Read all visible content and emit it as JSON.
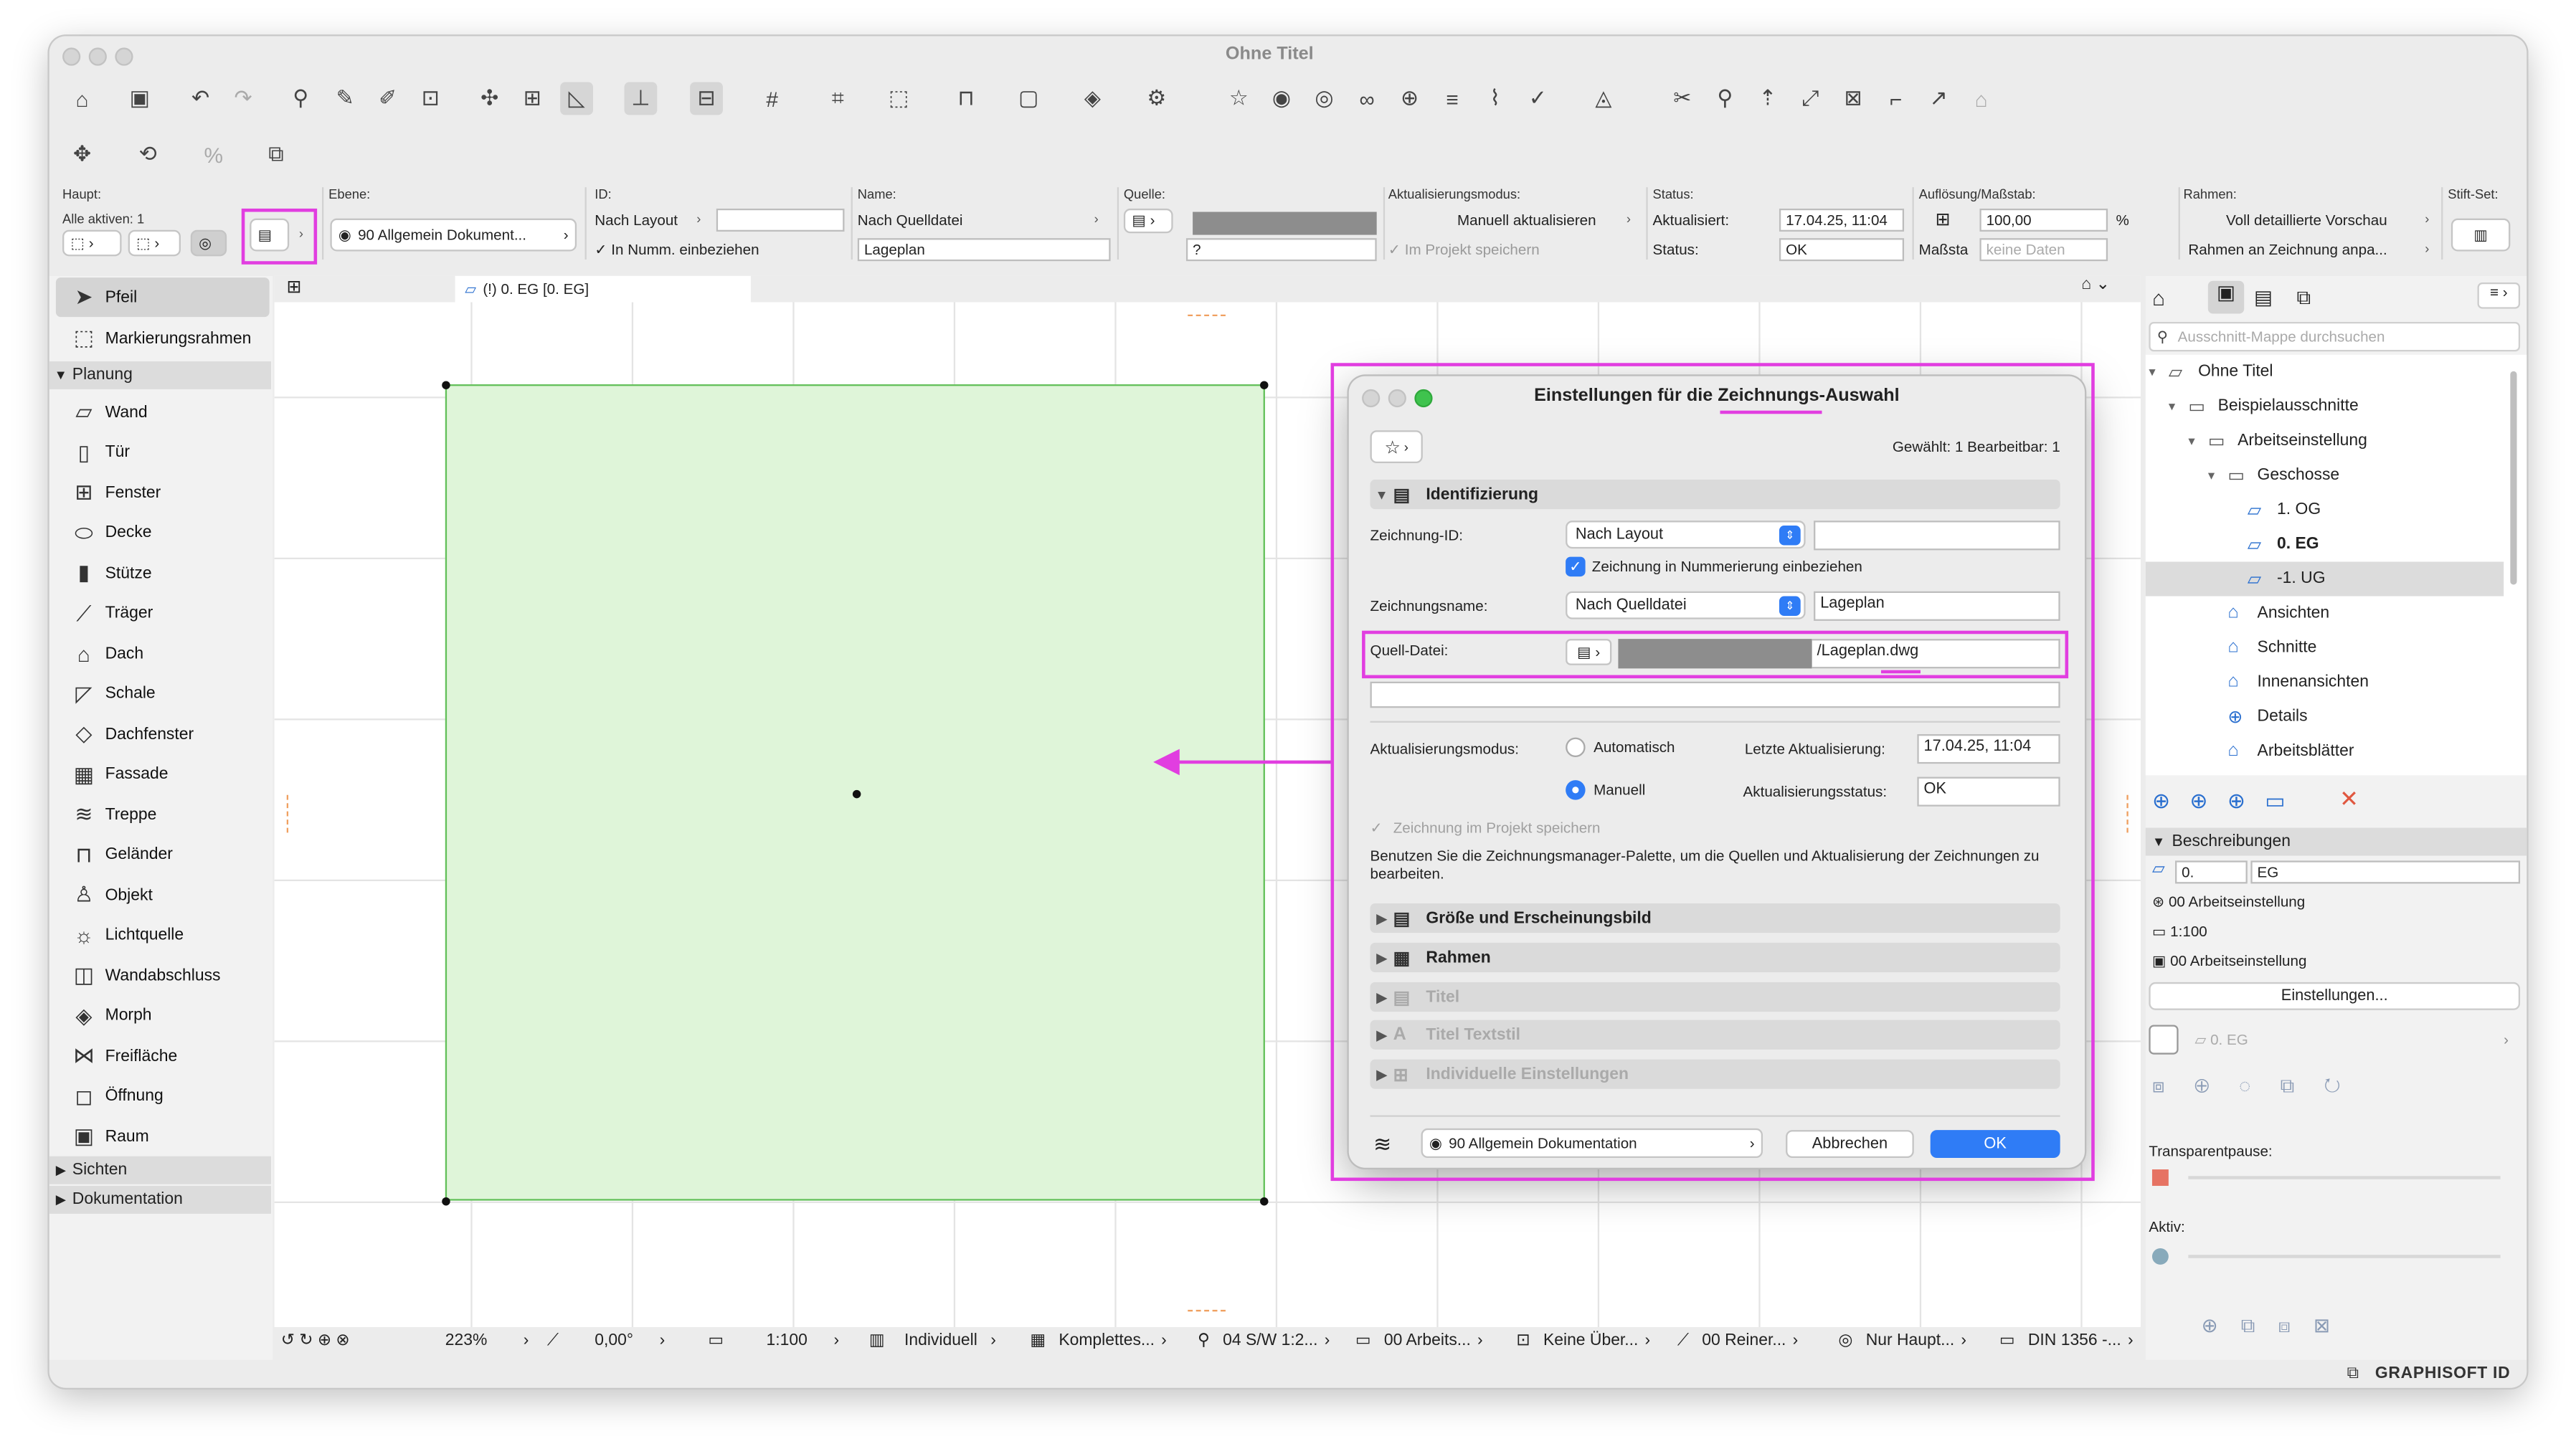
{
  "window": {
    "title": "Ohne Titel"
  },
  "infobox": {
    "haupt_label": "Haupt:",
    "alle_aktiven": "Alle aktiven: 1",
    "ebene_label": "Ebene:",
    "ebene_value": "90 Allgemein Dokument...",
    "id_label": "ID:",
    "id_mode": "Nach Layout",
    "id_include": "In Numm. einbeziehen",
    "name_label": "Name:",
    "name_mode": "Nach Quelldatei",
    "name_value": "Lageplan",
    "quelle_label": "Quelle:",
    "quelle_value": "?",
    "aktualisierungsmodus_label": "Aktualisierungsmodus:",
    "aktualisierungsmodus_value": "Manuell aktualisieren",
    "im_projekt": "Im Projekt speichern",
    "status_label": "Status:",
    "aktualisiert_label": "Aktualisiert:",
    "aktualisiert_value": "17.04.25, 11:04",
    "status2_label": "Status:",
    "status_value": "OK",
    "aufloesung_label": "Auflösung/Maßstab:",
    "aufloesung_value": "100,00",
    "aufloesung_unit": "%",
    "massstab_label": "Maßsta",
    "massstab_value": "keine Daten",
    "rahmen_label": "Rahmen:",
    "rahmen_value1": "Voll detaillierte Vorschau",
    "rahmen_value2": "Rahmen an Zeichnung anpa...",
    "stiftset_label": "Stift-Set:"
  },
  "toolbox": {
    "pfeil": "Pfeil",
    "markierungsrahmen": "Markierungsrahmen",
    "section_planung": "Planung",
    "tools": [
      {
        "label": "Wand",
        "icon": "wall-icon",
        "glyph": "▱"
      },
      {
        "label": "Tür",
        "icon": "door-icon",
        "glyph": "▯"
      },
      {
        "label": "Fenster",
        "icon": "window-icon",
        "glyph": "⊞"
      },
      {
        "label": "Decke",
        "icon": "slab-icon",
        "glyph": "⬭"
      },
      {
        "label": "Stütze",
        "icon": "column-icon",
        "glyph": "▮"
      },
      {
        "label": "Träger",
        "icon": "beam-icon",
        "glyph": "⟋"
      },
      {
        "label": "Dach",
        "icon": "roof-icon",
        "glyph": "⌂"
      },
      {
        "label": "Schale",
        "icon": "shell-icon",
        "glyph": "◸"
      },
      {
        "label": "Dachfenster",
        "icon": "skylight-icon",
        "glyph": "◇"
      },
      {
        "label": "Fassade",
        "icon": "curtain-wall-icon",
        "glyph": "▦"
      },
      {
        "label": "Treppe",
        "icon": "stair-icon",
        "glyph": "≋"
      },
      {
        "label": "Geländer",
        "icon": "railing-icon",
        "glyph": "⊓"
      },
      {
        "label": "Objekt",
        "icon": "object-icon",
        "glyph": "♙"
      },
      {
        "label": "Lichtquelle",
        "icon": "lamp-icon",
        "glyph": "☼"
      },
      {
        "label": "Wandabschluss",
        "icon": "wall-end-icon",
        "glyph": "◫"
      },
      {
        "label": "Morph",
        "icon": "morph-icon",
        "glyph": "◈"
      },
      {
        "label": "Freifläche",
        "icon": "mesh-icon",
        "glyph": "⋈"
      },
      {
        "label": "Öffnung",
        "icon": "opening-icon",
        "glyph": "◻"
      },
      {
        "label": "Raum",
        "icon": "zone-icon",
        "glyph": "▣"
      }
    ],
    "section_sichten": "Sichten",
    "section_dokumentation": "Dokumentation"
  },
  "canvas": {
    "tab_label": "(!) 0. EG [0. EG]"
  },
  "statusbar": {
    "zoom": "223%",
    "angle": "0,00°",
    "scale": "1:100",
    "struct": "Individuell",
    "model": "Komplettes...",
    "pen": "04 S/W 1:2...",
    "layer": "00 Arbeits...",
    "override": "Keine Über...",
    "reno": "00 Reiner...",
    "struct2": "Nur Haupt...",
    "dim": "DIN 1356 -..."
  },
  "dialog": {
    "title": "Einstellungen für die Zeichnungs-Auswahl",
    "selected": "Gewählt: 1 Bearbeitbar: 1",
    "sec_ident": "Identifizierung",
    "id_label": "Zeichnung-ID:",
    "id_mode": "Nach Layout",
    "id_value": "",
    "checkbox_numbering": "Zeichnung in Nummerierung einbeziehen",
    "name_label": "Zeichnungsname:",
    "name_mode": "Nach Quelldatei",
    "name_value": "Lageplan",
    "quelle_label": "Quell-Datei:",
    "quelle_file": "/Lageplan.dwg",
    "update_mode_label": "Aktualisierungsmodus:",
    "radio_auto": "Automatisch",
    "radio_manual": "Manuell",
    "last_update_label": "Letzte Aktualisierung:",
    "last_update_value": "17.04.25, 11:04",
    "update_status_label": "Aktualisierungsstatus:",
    "update_status_value": "OK",
    "store_in_project": "Zeichnung im Projekt speichern",
    "hint": "Benutzen Sie die Zeichnungsmanager-Palette, um die Quellen und Aktualisierung der Zeichnungen zu bearbeiten.",
    "sec_size": "Größe und Erscheinungsbild",
    "sec_frame": "Rahmen",
    "sec_title": "Titel",
    "sec_title_style": "Titel Textstil",
    "sec_individual": "Individuelle Einstellungen",
    "layer": "90 Allgemein Dokumentation",
    "cancel": "Abbrechen",
    "ok": "OK"
  },
  "navigator": {
    "search_placeholder": "Ausschnitt-Mappe durchsuchen",
    "items": [
      {
        "label": "Ohne Titel"
      },
      {
        "label": "Beispielausschnitte"
      },
      {
        "label": "Arbeitseinstellung"
      },
      {
        "label": "Geschosse"
      },
      {
        "label": "1. OG"
      },
      {
        "label": "0. EG"
      },
      {
        "label": "-1. UG"
      },
      {
        "label": "Ansichten"
      },
      {
        "label": "Schnitte"
      },
      {
        "label": "Innenansichten"
      },
      {
        "label": "Details"
      },
      {
        "label": "Arbeitsblätter"
      }
    ],
    "beschreibungen": "Beschreibungen",
    "desc_id": "0.",
    "desc_name": "EG",
    "desc_layer": "00 Arbeitseinstellung",
    "desc_scale": "1:100",
    "desc_layer2": "00 Arbeitseinstellung",
    "einstellungen": "Einstellungen...",
    "layout_ref": "0. EG",
    "transparent": "Transparentpause:",
    "aktiv": "Aktiv:",
    "brand": "GRAPHISOFT ID"
  },
  "colors": {
    "accent": "#2f7cf6",
    "highlight": "#e13ee0",
    "drawing_fill": "#dff5d9",
    "drawing_border": "#63c05a"
  }
}
